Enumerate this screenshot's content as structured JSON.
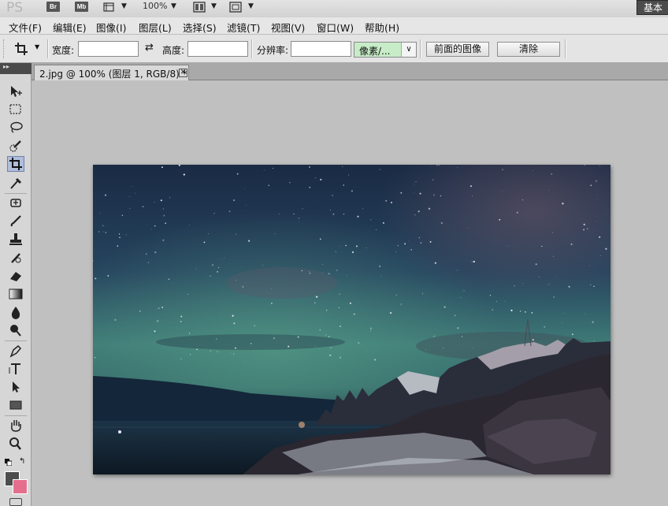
{
  "app": {
    "logo": "PS",
    "bridge_label": "Br",
    "minibridge_label": "Mb",
    "zoom": "100%",
    "workspace": "基本功"
  },
  "menu": [
    "文件(F)",
    "编辑(E)",
    "图像(I)",
    "图层(L)",
    "选择(S)",
    "滤镜(T)",
    "视图(V)",
    "窗口(W)",
    "帮助(H)"
  ],
  "options": {
    "width_label": "宽度:",
    "width_value": "",
    "swap_icon": "swap-arrows-icon",
    "height_label": "高度:",
    "height_value": "",
    "resolution_label": "分辨率:",
    "resolution_value": "",
    "unit": "像素/...",
    "front_image_button": "前面的图像",
    "clear_button": "清除"
  },
  "document": {
    "tab_title": "2.jpg @ 100% (图层 1, RGB/8) *"
  },
  "tools": [
    "move-tool-icon",
    "marquee-tool-icon",
    "lasso-tool-icon",
    "quick-selection-tool-icon",
    "crop-tool-icon",
    "eyedropper-tool-icon",
    "healing-brush-tool-icon",
    "brush-tool-icon",
    "clone-stamp-tool-icon",
    "history-brush-tool-icon",
    "eraser-tool-icon",
    "gradient-tool-icon",
    "blur-tool-icon",
    "dodge-tool-icon",
    "pen-tool-icon",
    "type-tool-icon",
    "path-selection-tool-icon",
    "rectangle-tool-icon",
    "hand-tool-icon",
    "zoom-tool-icon"
  ],
  "active_tool": "crop-tool-icon",
  "colors": {
    "foreground": "#4d4d4d",
    "background": "#e56e8e",
    "selected_tool_bg": "#aebedb",
    "unit_select_bg": "#c7ecc7"
  }
}
